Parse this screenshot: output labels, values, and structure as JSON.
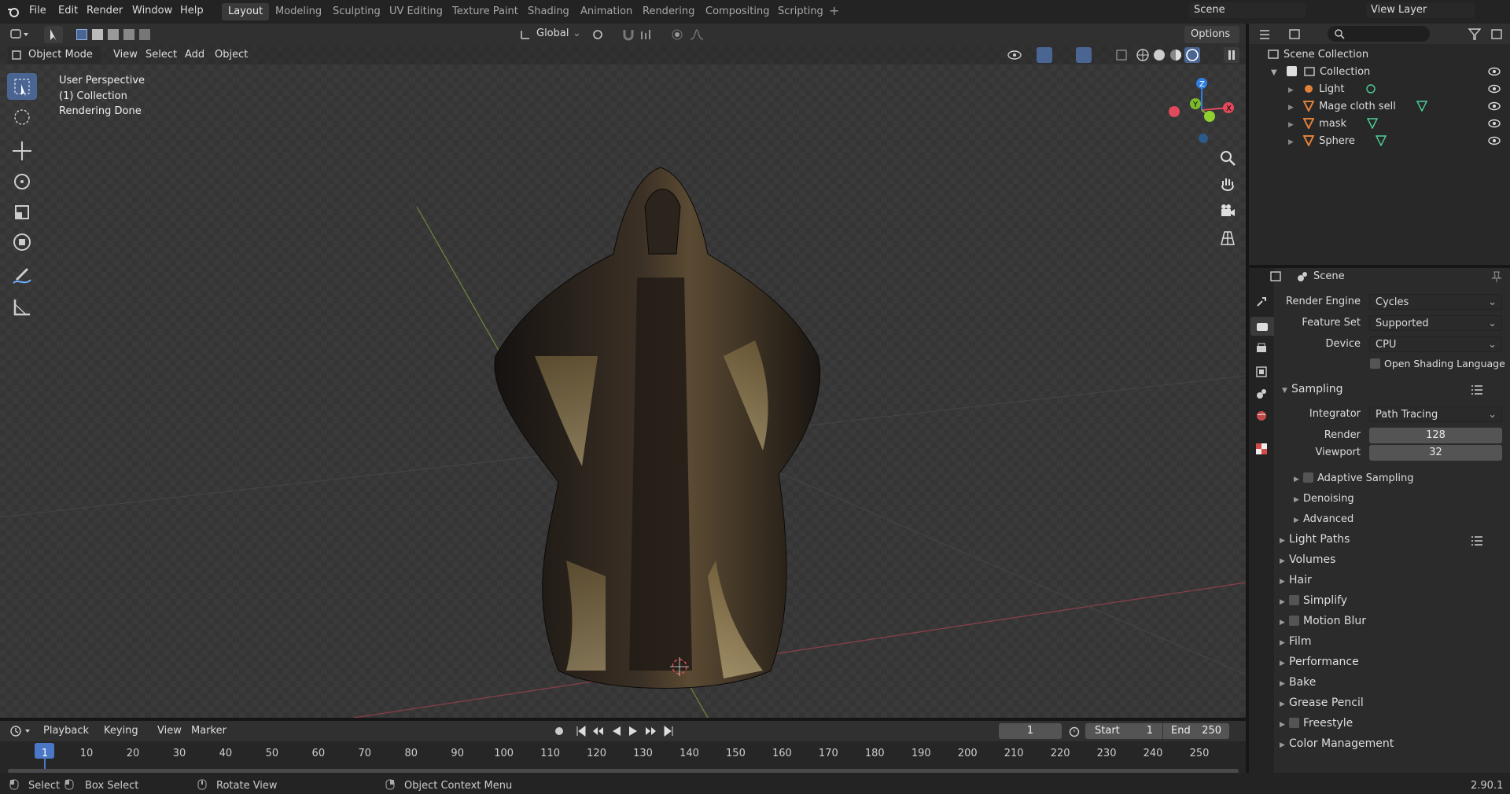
{
  "menu": {
    "file": "File",
    "edit": "Edit",
    "render": "Render",
    "window": "Window",
    "help": "Help"
  },
  "workspaces": [
    "Layout",
    "Modeling",
    "Sculpting",
    "UV Editing",
    "Texture Paint",
    "Shading",
    "Animation",
    "Rendering",
    "Compositing",
    "Scripting"
  ],
  "active_workspace": "Layout",
  "scene_field": "Scene",
  "view_layer_field": "View Layer",
  "header": {
    "orientation": "Global",
    "options": "Options",
    "mode": "Object Mode",
    "view": "View",
    "select": "Select",
    "add": "Add",
    "object": "Object"
  },
  "viewport": {
    "line1": "User Perspective",
    "line2": "(1) Collection",
    "line3": "Rendering Done",
    "gizmo_x": "X",
    "gizmo_y": "Y",
    "gizmo_z": "Z"
  },
  "outliner": {
    "scene_collection": "Scene Collection",
    "collection": "Collection",
    "items": [
      "Light",
      "Mage cloth sell",
      "mask",
      "Sphere"
    ]
  },
  "properties": {
    "context": "Scene",
    "render_engine_label": "Render Engine",
    "render_engine": "Cycles",
    "feature_set_label": "Feature Set",
    "feature_set": "Supported",
    "device_label": "Device",
    "device": "CPU",
    "osl": "Open Shading Language",
    "sampling": "Sampling",
    "integrator_label": "Integrator",
    "integrator": "Path Tracing",
    "render_label": "Render",
    "render_samples": "128",
    "viewport_label": "Viewport",
    "viewport_samples": "32",
    "adaptive": "Adaptive Sampling",
    "denoising": "Denoising",
    "advanced": "Advanced",
    "sections": [
      "Light Paths",
      "Volumes",
      "Hair",
      "Simplify",
      "Motion Blur",
      "Film",
      "Performance",
      "Bake",
      "Grease Pencil",
      "Freestyle",
      "Color Management"
    ]
  },
  "timeline": {
    "playback": "Playback",
    "keying": "Keying",
    "view": "View",
    "marker": "Marker",
    "current_frame": "1",
    "start_label": "Start",
    "start": "1",
    "end_label": "End",
    "end": "250",
    "ticks": [
      "1",
      "10",
      "20",
      "30",
      "40",
      "50",
      "60",
      "70",
      "80",
      "90",
      "100",
      "110",
      "120",
      "130",
      "140",
      "150",
      "160",
      "170",
      "180",
      "190",
      "200",
      "210",
      "220",
      "230",
      "240",
      "250"
    ]
  },
  "status": {
    "select": "Select",
    "box_select": "Box Select",
    "rotate_view": "Rotate View",
    "context_menu": "Object Context Menu",
    "version": "2.90.1"
  }
}
